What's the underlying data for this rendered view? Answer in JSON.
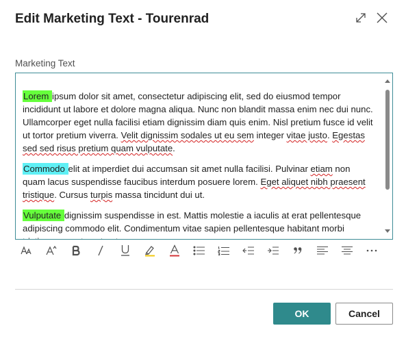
{
  "dialog": {
    "title": "Edit Marketing Text - Tourenrad",
    "expand_icon": "expand-icon",
    "close_icon": "close-icon"
  },
  "field": {
    "label": "Marketing Text"
  },
  "editor": {
    "paragraphs": [
      {
        "segments": [
          {
            "text": "Lorem ",
            "highlight": "#66ff3c"
          },
          {
            "text": "ipsum dolor sit amet, consectetur adipiscing elit, sed do eiusmod tempor incididunt ut labore et dolore magna aliqua. Nunc non blandit massa enim nec dui nunc. Ullamcorper eget nulla facilisi etiam dignissim diam quis enim. Nisl pretium fusce id velit ut tortor pretium viverra. "
          },
          {
            "text": "Velit dignissim sodales ut eu sem",
            "spell": true
          },
          {
            "text": " integer "
          },
          {
            "text": "vitae justo",
            "spell": true
          },
          {
            "text": ". "
          },
          {
            "text": "Egestas sed sed risus pretium quam vulputate",
            "spell": true
          },
          {
            "text": "."
          }
        ]
      },
      {
        "segments": [
          {
            "text": "Commodo ",
            "highlight": "#5ff0f5"
          },
          {
            "text": "elit at imperdiet dui accumsan sit amet nulla facilisi. Pulvinar "
          },
          {
            "text": "etiam",
            "spell": true
          },
          {
            "text": " non quam lacus suspendisse faucibus interdum posuere lorem. "
          },
          {
            "text": "Eget aliquet nibh praesent tristique",
            "spell": true
          },
          {
            "text": ". Cursus "
          },
          {
            "text": "turpis",
            "spell": true
          },
          {
            "text": " massa tincidunt dui ut."
          }
        ]
      },
      {
        "segments": [
          {
            "text": "Vulputate ",
            "highlight": "#66ff3c"
          },
          {
            "text": "dignissim suspendisse in est. Mattis molestie a iaculis at erat pellentesque adipiscing commodo elit. Condimentum vitae sapien pellentesque habitant morbi tristique senectus et netus."
          }
        ]
      }
    ]
  },
  "toolbar": {
    "tools": [
      {
        "name": "font-size-icon"
      },
      {
        "name": "font-style-icon"
      },
      {
        "name": "bold-icon"
      },
      {
        "name": "italic-icon"
      },
      {
        "name": "underline-icon"
      },
      {
        "name": "highlight-color-icon",
        "color": "#f2c811"
      },
      {
        "name": "font-color-icon",
        "color": "#d13438"
      },
      {
        "name": "bullet-list-icon"
      },
      {
        "name": "numbered-list-icon"
      },
      {
        "name": "decrease-indent-icon"
      },
      {
        "name": "increase-indent-icon"
      },
      {
        "name": "quote-icon"
      },
      {
        "name": "align-left-icon"
      },
      {
        "name": "align-center-icon"
      },
      {
        "name": "more-options-icon"
      }
    ]
  },
  "buttons": {
    "ok_label": "OK",
    "cancel_label": "Cancel"
  },
  "colors": {
    "primary": "#2f8a8c",
    "editor_border": "#3d8c96"
  }
}
